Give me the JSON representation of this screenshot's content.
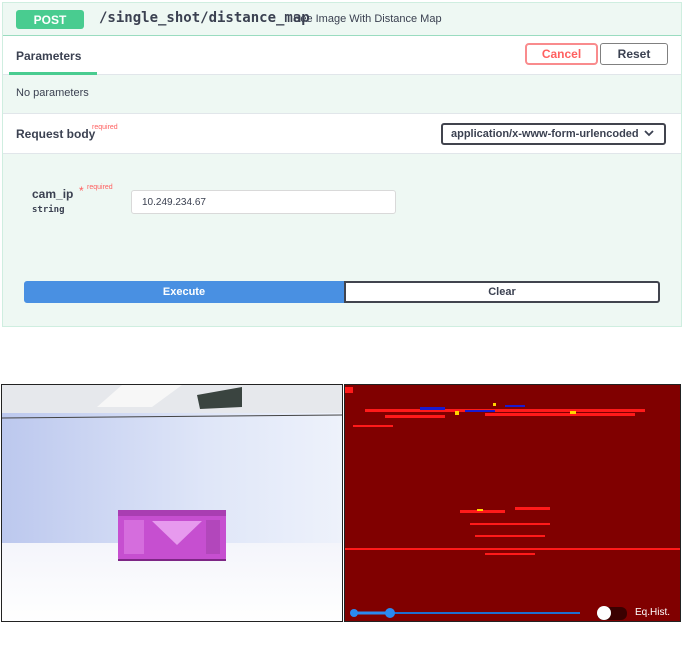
{
  "endpoint": {
    "method": "POST",
    "path": "/single_shot/distance_map",
    "description": "See Image With Distance Map"
  },
  "parameters": {
    "title": "Parameters",
    "cancel_label": "Cancel",
    "reset_label": "Reset",
    "empty_text": "No parameters"
  },
  "request_body": {
    "title": "Request body",
    "required_label": "required",
    "content_type": "application/x-www-form-urlencoded",
    "field": {
      "name": "cam_ip",
      "star": "*",
      "required_label": "required",
      "type": "string",
      "value": "10.249.234.67"
    }
  },
  "actions": {
    "execute_label": "Execute",
    "clear_label": "Clear"
  },
  "viewer": {
    "colors": {
      "map_background": "#800000",
      "box": "#c64fd0"
    },
    "slider_value": 0.08,
    "eq_hist_toggle": false,
    "eq_hist_label": "Eq.Hist."
  }
}
